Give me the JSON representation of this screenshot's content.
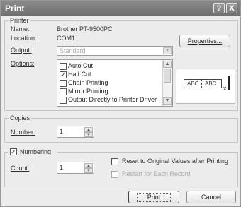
{
  "window": {
    "title": "Print",
    "help_glyph": "?",
    "close_glyph": "X"
  },
  "printer": {
    "legend": "Printer",
    "name_label": "Name:",
    "name_value": "Brother PT-9500PC",
    "location_label": "Location:",
    "location_value": "COM1:",
    "output_label": "Output:",
    "output_value": "Standard",
    "options_label": "Options:",
    "properties_button": "Properties..."
  },
  "options": [
    {
      "label": "Auto Cut",
      "checked": false
    },
    {
      "label": "Half Cut",
      "checked": true
    },
    {
      "label": "Chain Printing",
      "checked": false
    },
    {
      "label": "Mirror Printing",
      "checked": false
    },
    {
      "label": "Output Directly to Printer Driver",
      "checked": false
    }
  ],
  "preview": {
    "text1": "ABC",
    "text2": "ABC"
  },
  "copies": {
    "legend": "Copies",
    "number_label": "Number:",
    "number_value": "1"
  },
  "numbering": {
    "checkbox_label": "Numbering",
    "checked": true,
    "count_label": "Count:",
    "count_value": "1",
    "reset_label": "Reset to Original Values after Printing",
    "restart_label": "Restart for Each Record"
  },
  "buttons": {
    "print": "Print",
    "cancel": "Cancel"
  },
  "colors": {
    "titlebar": "#7a7a7a",
    "dialog_bg": "#ececec"
  }
}
